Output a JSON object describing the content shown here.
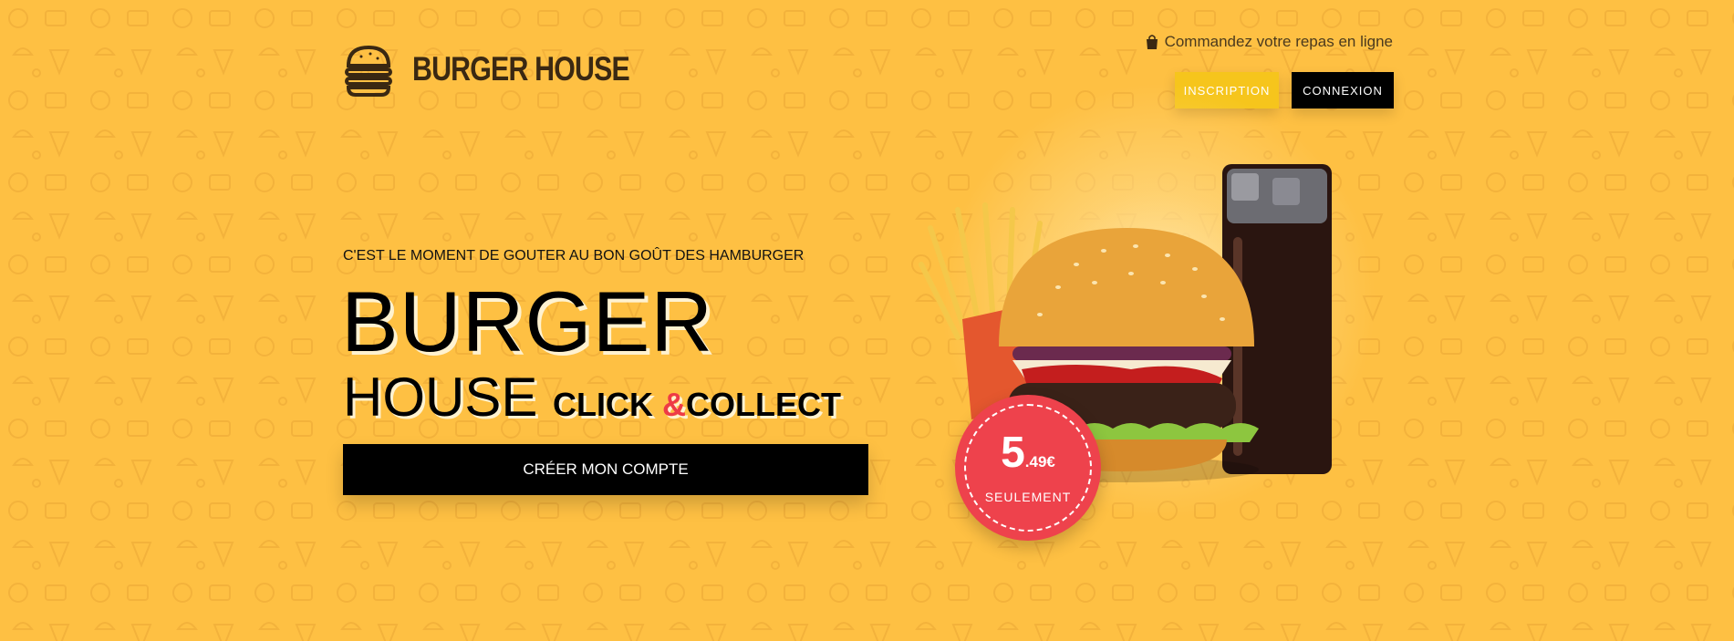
{
  "brand": {
    "name": "BURGER HOUSE"
  },
  "header": {
    "order_text": "Commandez votre repas en ligne",
    "inscription_label": "INSCRIPTION",
    "connexion_label": "CONNEXION"
  },
  "hero": {
    "tagline": "C'EST LE MOMENT DE GOUTER AU BON GOÛT DES HAMBURGER",
    "title_line1": "BURGER",
    "title_line2": "HOUSE",
    "click": "CLICK ",
    "amp": "&",
    "collect": "COLLECT",
    "cta_label": "CRÉER MON COMPTE"
  },
  "price": {
    "main": "5",
    "cents": ".49€",
    "note": "SEULEMENT"
  },
  "colors": {
    "background": "#fec043",
    "accent_red": "#ee424c",
    "button_yellow": "#f6c51c"
  },
  "icons": [
    "burger-logo-icon",
    "shopping-bag-icon"
  ]
}
